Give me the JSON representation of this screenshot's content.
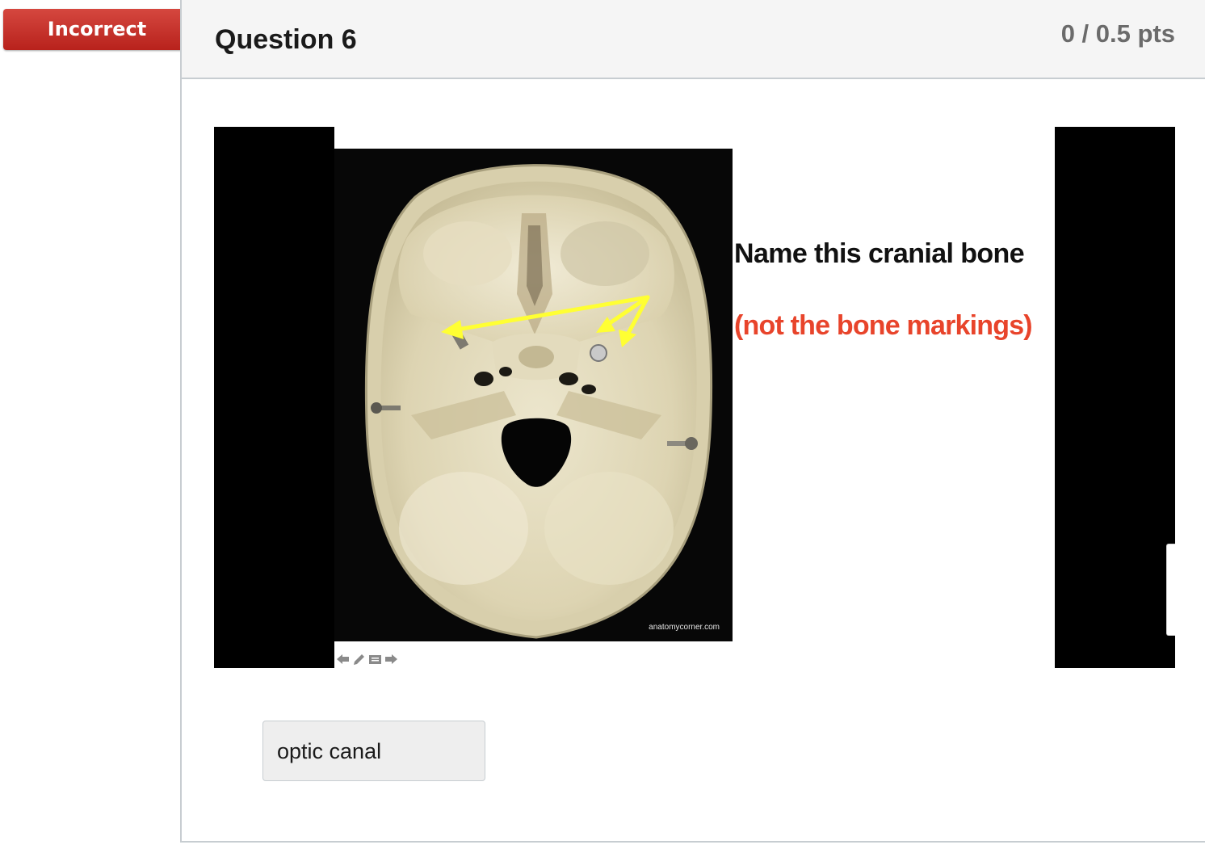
{
  "status_badge": {
    "label": "Incorrect",
    "color": "#c1302a"
  },
  "question": {
    "title": "Question 6",
    "points": "0 / 0.5 pts"
  },
  "slide": {
    "prompt": "Name this cranial bone",
    "note": "(not the bone markings)",
    "watermark": "anatomycorner.com",
    "arrow_color": "#ffff33",
    "note_color": "#e8442b",
    "controls": [
      "arrow-left-icon",
      "pencil-icon",
      "notes-icon",
      "arrow-right-icon"
    ]
  },
  "answer": {
    "value": "optic canal"
  }
}
